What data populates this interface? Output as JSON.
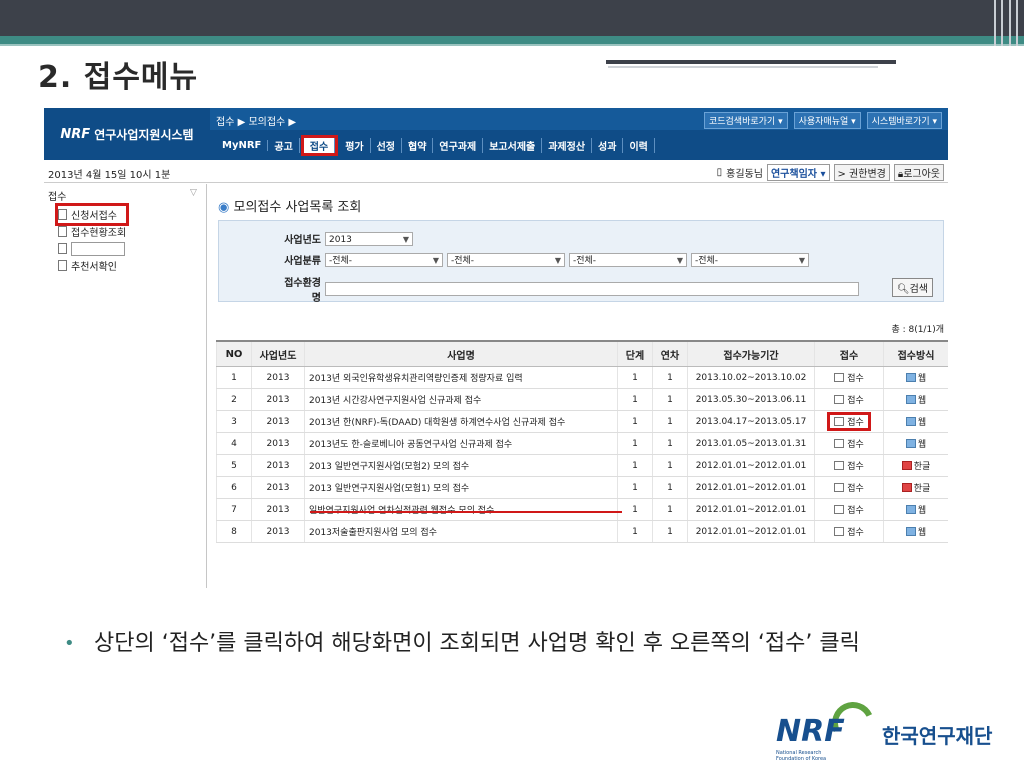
{
  "slide": {
    "title": "2. 접수메뉴",
    "bullet": "상단의 ‘접수’를 클릭하여 해당화면이 조회되면 사업명 확인 후 오른쪽의 ‘접수’ 클릭",
    "footer_logo_text": "NRF",
    "footer_logo_sub1": "National Research",
    "footer_logo_sub2": "Foundation of Korea",
    "footer_org": "한국연구재단"
  },
  "app": {
    "logo_mark": "NRF",
    "logo_text": "연구사업지원시스템",
    "breadcrumb": "접수 ▶ 모의접수 ▶",
    "quick_links": [
      "코드검색바로가기 ▾",
      "사용자매뉴얼 ▾",
      "시스템바로가기 ▾"
    ],
    "nav": [
      "MyNRF",
      "공고",
      "접수",
      "평가",
      "선정",
      "협약",
      "연구과제",
      "보고서제출",
      "과제정산",
      "성과",
      "이력"
    ],
    "date": "2013년 4월 15일 10시 1분",
    "user_name": "홍길동님",
    "user_role": "연구책임자 ▾",
    "role_change": "> 권한변경",
    "logout": "로그아웃"
  },
  "sidebar": {
    "header": "접수",
    "items": [
      "신청서접수",
      "접수현황조회",
      "",
      "추천서확인"
    ]
  },
  "main": {
    "title": "모의접수 사업목록 조회",
    "search": {
      "year_label": "사업년도",
      "year_value": "2013",
      "category_label": "사업분류",
      "category_values": [
        "-전체-",
        "-전체-",
        "-전체-",
        "-전체-"
      ],
      "env_label": "접수환경명",
      "button": "검색"
    },
    "total": "총 : 8(1/1)개",
    "columns": [
      "NO",
      "사업년도",
      "사업명",
      "단계",
      "연차",
      "접수가능기간",
      "접수",
      "접수방식"
    ],
    "rows": [
      {
        "no": "1",
        "year": "2013",
        "name": "2013년 외국인유학생유치관리역량인증제 정량자료 입력",
        "stage": "1",
        "annual": "1",
        "period": "2013.10.02~2013.10.02",
        "action": "접수",
        "method": "웹"
      },
      {
        "no": "2",
        "year": "2013",
        "name": "2013년 시간강사연구지원사업 신규과제 접수",
        "stage": "1",
        "annual": "1",
        "period": "2013.05.30~2013.06.11",
        "action": "접수",
        "method": "웹"
      },
      {
        "no": "3",
        "year": "2013",
        "name": "2013년 한(NRF)-독(DAAD) 대학원생 하계연수사업 신규과제 접수",
        "stage": "1",
        "annual": "1",
        "period": "2013.04.17~2013.05.17",
        "action": "접수",
        "method": "웹"
      },
      {
        "no": "4",
        "year": "2013",
        "name": "2013년도 한-슬로베니아 공동연구사업 신규과제 접수",
        "stage": "1",
        "annual": "1",
        "period": "2013.01.05~2013.01.31",
        "action": "접수",
        "method": "웹"
      },
      {
        "no": "5",
        "year": "2013",
        "name": "2013 일반연구지원사업(모험2) 모의 접수",
        "stage": "1",
        "annual": "1",
        "period": "2012.01.01~2012.01.01",
        "action": "접수",
        "method": "한글"
      },
      {
        "no": "6",
        "year": "2013",
        "name": "2013 일반연구지원사업(모험1) 모의 접수",
        "stage": "1",
        "annual": "1",
        "period": "2012.01.01~2012.01.01",
        "action": "접수",
        "method": "한글"
      },
      {
        "no": "7",
        "year": "2013",
        "name": "일반연구지원사업 연차실적관련 웹접수 모의 접수",
        "stage": "1",
        "annual": "1",
        "period": "2012.01.01~2012.01.01",
        "action": "접수",
        "method": "웹"
      },
      {
        "no": "8",
        "year": "2013",
        "name": "2013저술출판지원사업 모의 접수",
        "stage": "1",
        "annual": "1",
        "period": "2012.01.01~2012.01.01",
        "action": "접수",
        "method": "웹"
      }
    ]
  }
}
